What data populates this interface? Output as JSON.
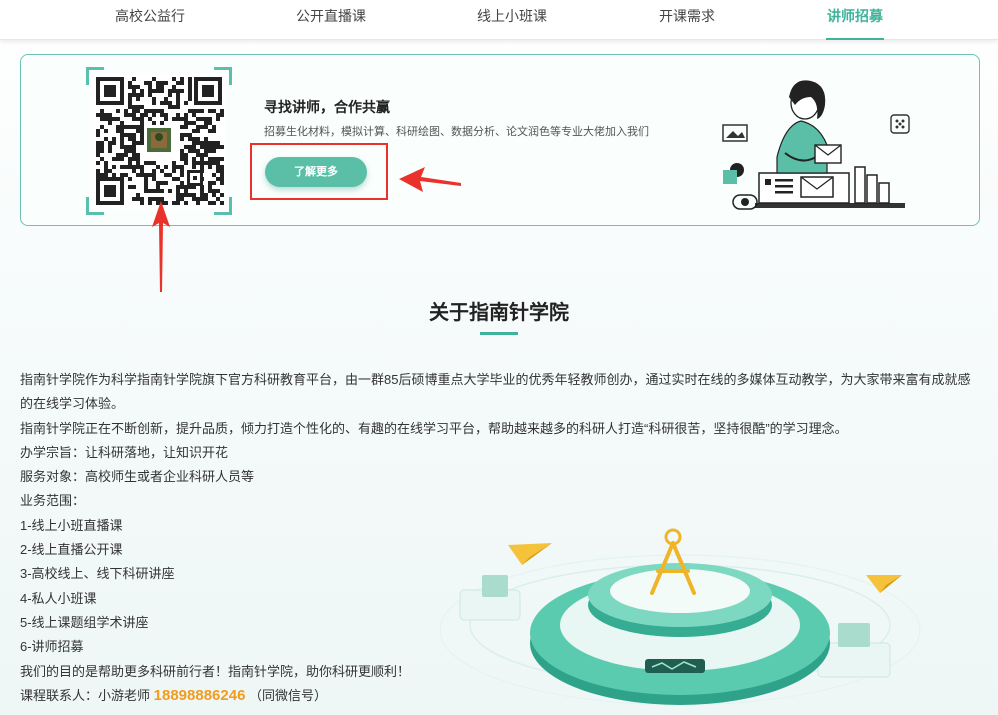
{
  "nav": {
    "items": [
      {
        "label": "高校公益行"
      },
      {
        "label": "公开直播课"
      },
      {
        "label": "线上小班课"
      },
      {
        "label": "开课需求"
      },
      {
        "label": "讲师招募"
      }
    ],
    "active_index": 4
  },
  "banner": {
    "title": "寻找讲师，合作共赢",
    "subtitle": "招募生化材料，模拟计算、科研绘图、数据分析、论文润色等专业大佬加入我们",
    "button_label": "了解更多",
    "qr_icon": "qr-code-icon",
    "illustration": "woman-with-charts-illustration"
  },
  "about": {
    "title": "关于指南针学院",
    "paragraphs": [
      "指南针学院作为科学指南针学院旗下官方科研教育平台，由一群85后硕博重点大学毕业的优秀年轻教师创办，通过实时在线的多媒体互动教学，为大家带来富有成就感的在线学习体验。",
      "指南针学院正在不断创新，提升品质，倾力打造个性化的、有趣的在线学习平台，帮助越来越多的科研人打造“科研很苦，坚持很酷”的学习理念。",
      "办学宗旨：让科研落地，让知识开花",
      "服务对象：高校师生或者企业科研人员等",
      "业务范围：",
      "1-线上小班直播课",
      "2-线上直播公开课",
      "3-高校线上、线下科研讲座",
      "4-私人小班课",
      "5-线上课题组学术讲座",
      "6-讲师招募",
      "我们的目的是帮助更多科研前行者！指南针学院，助你科研更顺利！"
    ],
    "contact_label": "课程联系人：小游老师",
    "contact_phone": "18898886246",
    "contact_note": "（同微信号）"
  },
  "colors": {
    "accent": "#3fb39b",
    "phone": "#f29b1d",
    "annotation_red": "#e8322a"
  }
}
